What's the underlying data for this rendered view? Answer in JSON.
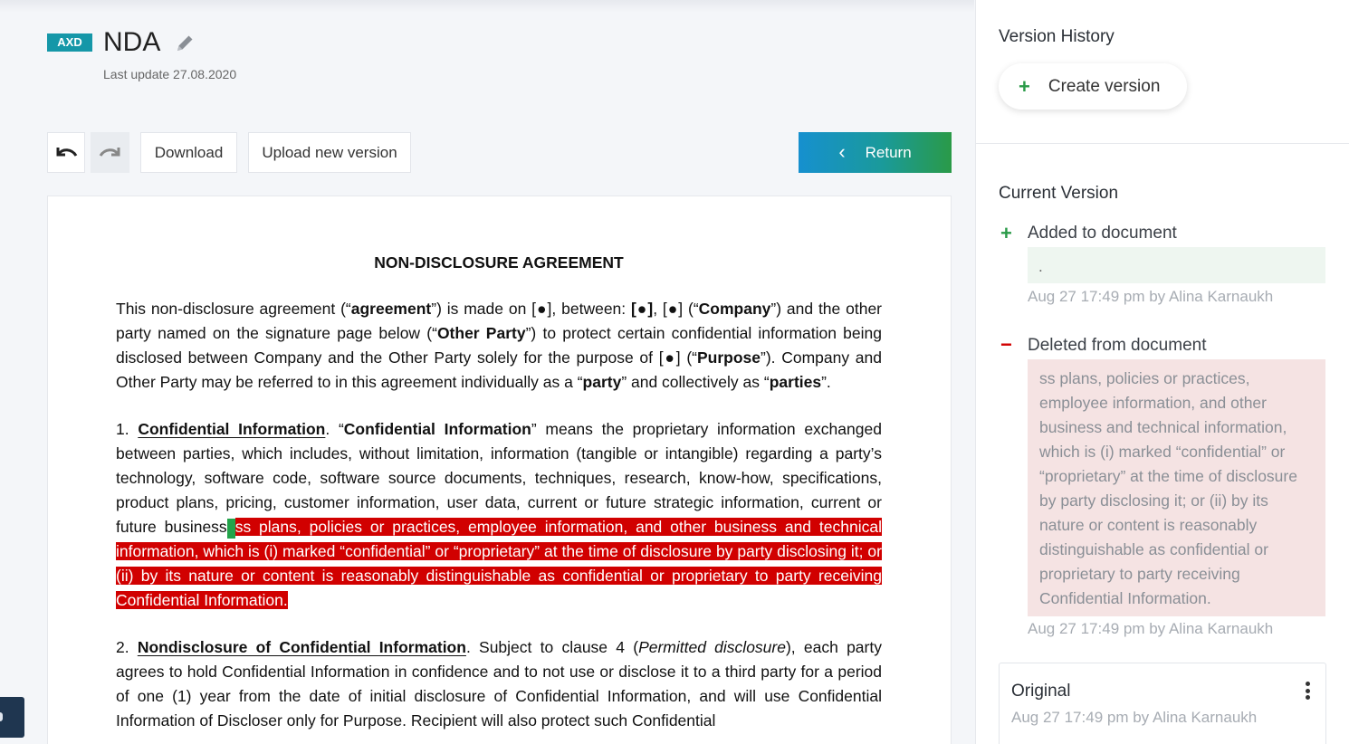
{
  "header": {
    "badge": "AXD",
    "title": "NDA",
    "last_update": "Last update 27.08.2020"
  },
  "toolbar": {
    "download_label": "Download",
    "upload_label": "Upload new version",
    "return_label": "Return"
  },
  "document": {
    "heading": "NON-DISCLOSURE AGREEMENT",
    "p1": {
      "t1": "This non-disclosure agreement (“",
      "b1": "agreement",
      "t2": "”) is made on [●], between: ",
      "b2": "[●]",
      "t3": ", [●] (“",
      "b3": "Company",
      "t4": "”) and the other party named on the signature page below (“",
      "b4": "Other Party",
      "t5": "”) to protect certain confidential information being disclosed between Company and the Other Party solely for the purpose of [●] (“",
      "b5": "Purpose",
      "t6": "”). Company and Other Party may be referred to in this agreement individually as a “",
      "b6": "party",
      "t7": "” and collectively as “",
      "b7": "parties",
      "t8": "”."
    },
    "p2": {
      "num": "1. ",
      "heading": "Confidential Information",
      "t1": ". “",
      "b1": "Confidential Information",
      "t2": "” means the proprietary information exchanged between parties, which includes, without limitation, information (tangible or intangible) regarding a party’s technology, software code, software source documents, techniques, research, know-how, specifications, product plans, pricing, customer information, user data, current or future strategic information, current or future business",
      "added": ".",
      "deleted": "ss plans, policies or practices, employee information, and other business and technical information, which is (i) marked “confidential” or “proprietary” at the time of disclosure by party disclosing it; or (ii) by its nature or content is reasonably distinguishable as confidential or proprietary to party receiving Confidential Information."
    },
    "p3": {
      "num": "2. ",
      "heading": "Nondisclosure of Confidential Information",
      "t1": ". Subject to clause 4 (",
      "i1": "Permitted disclosure",
      "t2": "), each party agrees to hold Confidential Information in confidence and to not use or disclose it to a third party for a period of one (1) year from the date of initial disclosure of Confidential Information, and will use Confidential Information of Discloser only for Purpose. Recipient will also protect such Confidential"
    }
  },
  "version_panel": {
    "title": "Version History",
    "create_label": "Create version",
    "current_title": "Current Version",
    "added_label": "Added to document",
    "added_text": ".",
    "added_meta": "Aug 27 17:49 pm by Alina Karnaukh",
    "deleted_label": "Deleted from document",
    "deleted_text": "ss plans, policies or practices, employee information, and other business and technical information, which is (i) marked “confidential” or “proprietary” at the time of disclosure by party disclosing it; or (ii) by its nature or content is reasonably distinguishable as confidential or proprietary to party receiving Confidential Information.",
    "deleted_meta": "Aug 27 17:49 pm by Alina Karnaukh",
    "original_title": "Original",
    "original_meta": "Aug 27 17:49 pm by Alina Karnaukh"
  },
  "colors": {
    "badge": "#1597a8",
    "deleted_highlight": "#d10000",
    "added_marker": "#22a34a",
    "return_gradient_start": "#1690cf",
    "return_gradient_end": "#2a9a48"
  },
  "icons": {
    "edit": "pencil-icon",
    "undo": "undo-icon",
    "redo": "redo-icon",
    "return": "chevron-left-icon",
    "create": "plus-icon",
    "added": "plus-icon",
    "deleted": "minus-icon",
    "more": "kebab-menu-icon"
  }
}
